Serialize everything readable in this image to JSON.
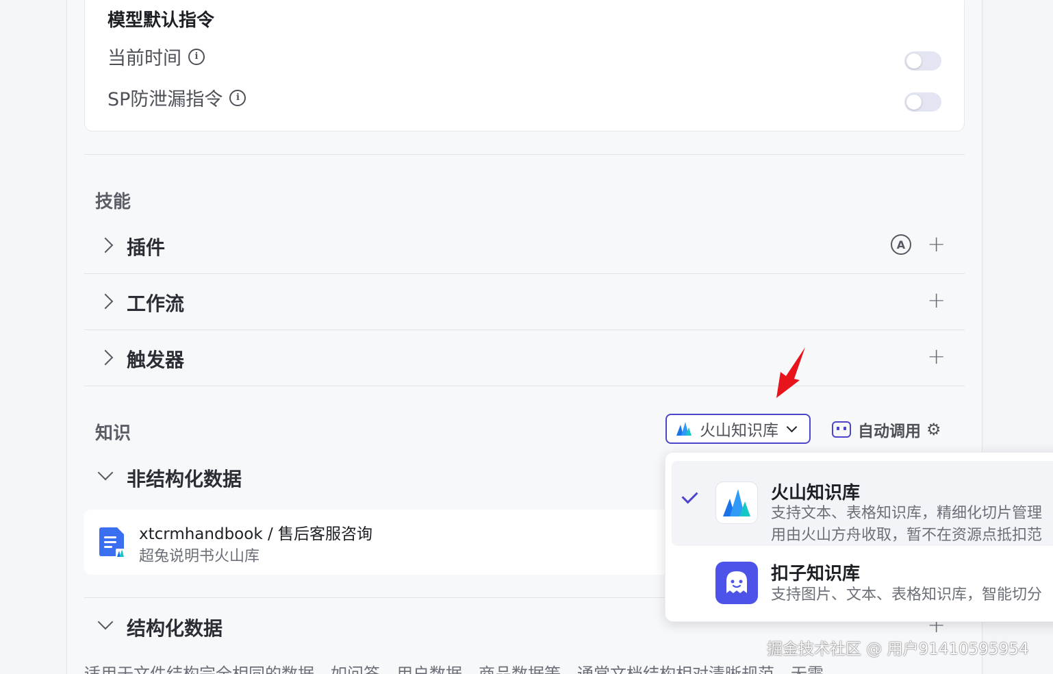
{
  "model_defaults": {
    "title": "模型默认指令",
    "options": [
      {
        "label": "当前时间",
        "enabled": false
      },
      {
        "label": "SP防泄漏指令",
        "enabled": false
      }
    ]
  },
  "skills": {
    "title": "技能",
    "rows": [
      {
        "label": "插件",
        "auto_icon_text": "A",
        "plus": "+"
      },
      {
        "label": "工作流",
        "plus": "+"
      },
      {
        "label": "触发器",
        "plus": "+"
      }
    ]
  },
  "knowledge": {
    "title": "知识",
    "selector_value": "火山知识库",
    "auto_call_label": "自动调用",
    "unstructured": {
      "title": "非结构化数据",
      "file": {
        "name": "xtcrmhandbook / 售后客服咨询",
        "sub": "超兔说明书火山库"
      }
    },
    "structured": {
      "title": "结构化数据",
      "plus": "+",
      "description": "适用于文件结构完全相同的数据，如问答、用户数据、商品数据等，通常文档结构相对清晰规范，无需"
    }
  },
  "dropdown": {
    "items": [
      {
        "title": "火山知识库",
        "desc_line1": "支持文本、表格知识库，精细化切片管理",
        "desc_line2": "用由火山方舟收取，暂不在资源点抵扣范",
        "selected": true,
        "icon": "volcano-logo-icon"
      },
      {
        "title": "扣子知识库",
        "desc_line1": "支持图片、文本、表格知识库，智能切分",
        "selected": false,
        "icon": "coze-logo-icon"
      }
    ]
  },
  "watermark": "掘金技术社区 @ 用户91410595954",
  "colors": {
    "accent": "#4c45cc",
    "annotation_arrow": "#e8141c"
  }
}
